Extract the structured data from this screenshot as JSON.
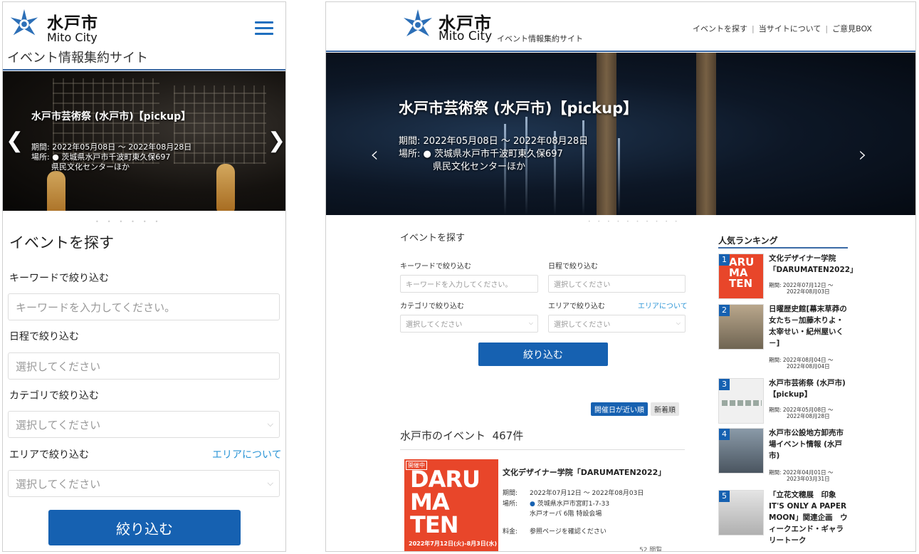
{
  "brand": {
    "name_ja": "水戸市",
    "name_en": "Mito City",
    "site_name": "イベント情報集約サイト"
  },
  "nav": {
    "find_event": "イベントを探す",
    "about": "当サイトについて",
    "feedback": "ご意見BOX"
  },
  "hero": {
    "title": "水戸市芸術祭 (水戸市)【pickup】",
    "period_label": "期間:",
    "period": "2022年05月08日 ～ 2022年08月28日",
    "place_label": "場所:",
    "place": "茨城県水戸市千波町東久保697",
    "place2": "県民文化センターほか"
  },
  "search": {
    "heading": "イベントを探す",
    "keyword_label": "キーワードで絞り込む",
    "keyword_placeholder": "キーワードを入力してください。",
    "date_label": "日程で絞り込む",
    "date_placeholder": "選択してください",
    "category_label": "カテゴリで絞り込む",
    "category_value": "選択してください",
    "area_label": "エリアで絞り込む",
    "area_link": "エリアについて",
    "area_value": "選択してください",
    "submit": "絞り込む"
  },
  "sort": {
    "near": "開催日が近い順",
    "newest": "新着順"
  },
  "results": {
    "label": "水戸市のイベント",
    "count": "467件"
  },
  "event": {
    "badge": "開催中",
    "thumb_line1": "DARU",
    "thumb_line2": "MA",
    "thumb_line3": "TEN",
    "thumb_dates": "2022年7月12日(火)-8月3日(水)",
    "title": "文化デザイナー学院「DARUMATEN2022」",
    "period_label": "期間:",
    "period": "2022年07月12日 ～ 2022年08月03日",
    "place_label": "場所:",
    "place": "茨城県水戸市宮町1-7-33",
    "place2": "水戸オーパ 6階 特設会場",
    "fee_label": "料金:",
    "fee": "参照ページを確認ください",
    "views": "52 閲覧"
  },
  "ranking": {
    "title": "人気ランキング",
    "period_label": "期間:",
    "items": [
      {
        "num": "1",
        "title": "文化デザイナー学院「DARUMATEN2022」",
        "start": "2022年07月12日 ～",
        "end": "2022年08月03日"
      },
      {
        "num": "2",
        "title": "日曜歴史館[幕末草莽の女たち－加藤木りよ・太宰せい・紀州屋いく－]",
        "start": "2022年08月04日 ～",
        "end": "2022年08月04日"
      },
      {
        "num": "3",
        "title": "水戸市芸術祭 (水戸市)【pickup】",
        "start": "2022年05月08日 ～",
        "end": "2022年08月28日"
      },
      {
        "num": "4",
        "title": "水戸市公設地方卸売市場イベント情報 (水戸市)",
        "start": "2022年04月01日 ～",
        "end": "2023年03月31日"
      },
      {
        "num": "5",
        "title": "「立花文穂展　印象 IT'S ONLY A PAPER MOON」関連企画　ウィークエンド・ギャラリートーク",
        "start": "",
        "end": ""
      }
    ]
  },
  "colors": {
    "brand_blue": "#1661b1",
    "header_rule": "#3b6aa6",
    "link": "#2a94d6",
    "event_red": "#e8462a"
  }
}
